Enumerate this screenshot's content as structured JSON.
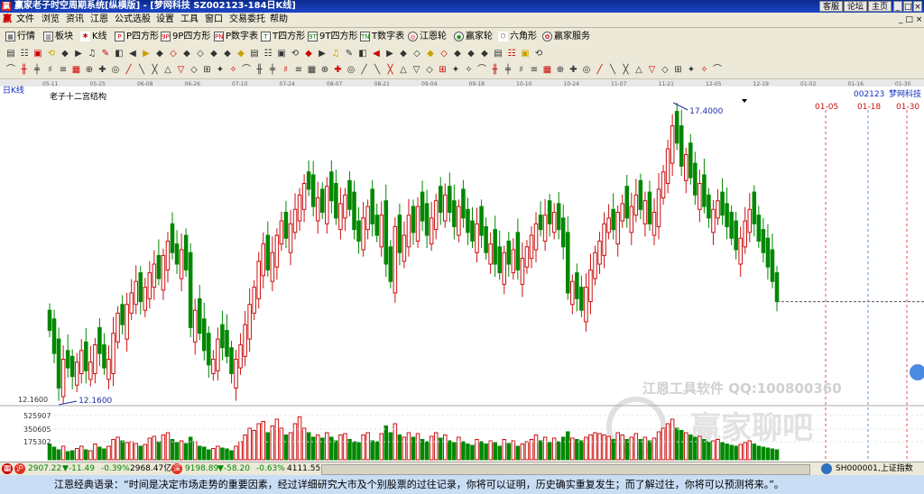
{
  "window": {
    "logo_text": "赢",
    "title": "赢家老子时空周期系统[纵横版] - [梦网科技  SZ002123-184日K线]",
    "buttons": [
      "客服",
      "论坛",
      "主页"
    ]
  },
  "menu": [
    "文件",
    "浏览",
    "资讯",
    "江恩",
    "公式选股",
    "设置",
    "工具",
    "窗口",
    "交易委托",
    "帮助"
  ],
  "toolbar1": [
    {
      "icon": "grid-icon",
      "label": "行情"
    },
    {
      "icon": "blocks-icon",
      "label": "板块"
    },
    {
      "icon": "candle-icon",
      "label": "K线"
    },
    {
      "icon": "P",
      "label": "P四方形"
    },
    {
      "icon": "9P",
      "label": "9P四方形"
    },
    {
      "icon": "PN",
      "label": "P数字表"
    },
    {
      "icon": "T",
      "label": "T四方形"
    },
    {
      "icon": "9T",
      "label": "9T四方形"
    },
    {
      "icon": "TN",
      "label": "T数字表"
    },
    {
      "icon": "wheel-icon",
      "label": "江恩轮"
    },
    {
      "icon": "wheel-icon",
      "label": "赢家轮"
    },
    {
      "icon": "hexagon-icon",
      "label": "六角形"
    },
    {
      "icon": "service-icon",
      "label": "赢家服务"
    }
  ],
  "chart_data": {
    "type": "candlestick",
    "period_label": "日K线",
    "indicator_label": "老子十二宫结构",
    "stock_code": "002123",
    "stock_name": "梦网科技",
    "x_dates": [
      "05-11",
      "05-25",
      "06-08",
      "06-26",
      "07-10",
      "07-24",
      "08-07",
      "08-21",
      "09-04",
      "09-18",
      "10-10",
      "10-24",
      "11-07",
      "11-21",
      "12-05",
      "12-19",
      "01-02",
      "01-16",
      "01-30"
    ],
    "future_marks": [
      "01-05",
      "01-18",
      "01-30"
    ],
    "high_label": "17.4000",
    "low_label": "12.1600",
    "low_axis_label": "12.1600",
    "ohlc_close": [
      13.45,
      13.05,
      12.45,
      12.95,
      12.8,
      12.65,
      12.9,
      13.1,
      12.75,
      12.9,
      13.2,
      13.05,
      12.8,
      12.95,
      13.4,
      13.75,
      13.55,
      13.9,
      14.1,
      14.3,
      13.95,
      14.2,
      14.45,
      14.6,
      14.35,
      14.75,
      15.0,
      14.8,
      14.6,
      14.85,
      14.5,
      13.5,
      13.8,
      13.4,
      13.1,
      12.85,
      12.95,
      13.3,
      13.15,
      13.0,
      12.7,
      12.95,
      13.2,
      13.55,
      13.9,
      14.2,
      14.65,
      14.95,
      14.5,
      14.8,
      15.1,
      15.35,
      15.05,
      15.3,
      15.55,
      15.8,
      16.0,
      15.9,
      15.6,
      15.75,
      15.5,
      15.95,
      15.7,
      15.4,
      15.65,
      15.8,
      15.55,
      15.2,
      15.0,
      15.4,
      15.6,
      15.3,
      15.1,
      15.45,
      14.6,
      14.3,
      15.25,
      14.8,
      15.1,
      15.45,
      15.15,
      15.6,
      15.35,
      15.1,
      15.4,
      15.7,
      15.5,
      15.8,
      15.5,
      15.25,
      15.6,
      15.4,
      15.15,
      15.0,
      15.3,
      15.1,
      14.8,
      14.95,
      14.6,
      14.45,
      14.8,
      14.6,
      14.85,
      14.5,
      14.7,
      14.9,
      15.1,
      15.3,
      15.2,
      15.45,
      15.3,
      15.5,
      15.2,
      14.9,
      14.1,
      14.3,
      14.0,
      13.8,
      14.2,
      14.5,
      14.8,
      15.0,
      15.3,
      15.4,
      15.2,
      15.5,
      15.65,
      15.4,
      15.6,
      15.8,
      15.55,
      15.7,
      15.3,
      15.5,
      15.9,
      16.2,
      16.6,
      17.0,
      16.7,
      16.3,
      16.5,
      16.1,
      15.8,
      16.0,
      15.6,
      15.4,
      15.55,
      15.7,
      15.45,
      15.25,
      15.05,
      14.85,
      15.05,
      15.35,
      15.55,
      15.3,
      15.0,
      14.8,
      14.55,
      14.3,
      13.95
    ],
    "ohlc_up": [
      false,
      false,
      false,
      true,
      false,
      false,
      true,
      true,
      false,
      true,
      true,
      false,
      false,
      true,
      true,
      true,
      false,
      true,
      true,
      true,
      false,
      true,
      true,
      true,
      false,
      true,
      true,
      false,
      false,
      true,
      false,
      false,
      true,
      false,
      false,
      false,
      true,
      true,
      false,
      false,
      false,
      true,
      true,
      true,
      true,
      true,
      true,
      true,
      false,
      true,
      true,
      true,
      false,
      true,
      true,
      true,
      true,
      false,
      false,
      true,
      false,
      true,
      false,
      false,
      true,
      true,
      false,
      false,
      false,
      true,
      true,
      false,
      false,
      true,
      false,
      false,
      true,
      false,
      true,
      true,
      false,
      true,
      false,
      false,
      true,
      true,
      false,
      true,
      false,
      false,
      true,
      false,
      false,
      false,
      true,
      false,
      false,
      true,
      false,
      false,
      true,
      false,
      true,
      false,
      true,
      true,
      true,
      true,
      false,
      true,
      false,
      true,
      false,
      false,
      false,
      true,
      false,
      false,
      true,
      true,
      true,
      true,
      true,
      true,
      false,
      true,
      true,
      false,
      true,
      true,
      false,
      true,
      false,
      true,
      true,
      true,
      true,
      true,
      false,
      false,
      true,
      false,
      false,
      true,
      false,
      false,
      true,
      true,
      false,
      false,
      false,
      false,
      true,
      true,
      true,
      false,
      false,
      false,
      false,
      false,
      false
    ],
    "volumes": [
      0.35,
      0.28,
      0.22,
      0.3,
      0.18,
      0.2,
      0.25,
      0.3,
      0.22,
      0.2,
      0.35,
      0.28,
      0.24,
      0.3,
      0.45,
      0.5,
      0.42,
      0.38,
      0.4,
      0.36,
      0.3,
      0.34,
      0.48,
      0.52,
      0.4,
      0.55,
      0.6,
      0.45,
      0.38,
      0.42,
      0.36,
      0.5,
      0.4,
      0.3,
      0.28,
      0.22,
      0.25,
      0.3,
      0.26,
      0.24,
      0.2,
      0.3,
      0.4,
      0.55,
      0.7,
      0.65,
      0.8,
      0.85,
      0.6,
      0.75,
      0.9,
      0.7,
      0.55,
      0.6,
      0.8,
      0.95,
      0.7,
      0.6,
      0.5,
      0.55,
      0.48,
      0.6,
      0.5,
      0.42,
      0.55,
      0.58,
      0.45,
      0.4,
      0.38,
      0.55,
      0.6,
      0.42,
      0.4,
      0.58,
      0.75,
      0.6,
      0.8,
      0.55,
      0.5,
      0.6,
      0.5,
      0.58,
      0.45,
      0.4,
      0.52,
      0.6,
      0.48,
      0.55,
      0.42,
      0.38,
      0.5,
      0.4,
      0.35,
      0.32,
      0.45,
      0.4,
      0.35,
      0.42,
      0.38,
      0.3,
      0.45,
      0.36,
      0.42,
      0.3,
      0.35,
      0.4,
      0.45,
      0.55,
      0.42,
      0.5,
      0.38,
      0.48,
      0.4,
      0.5,
      0.62,
      0.48,
      0.45,
      0.42,
      0.5,
      0.55,
      0.6,
      0.58,
      0.55,
      0.52,
      0.45,
      0.6,
      0.55,
      0.45,
      0.5,
      0.58,
      0.45,
      0.5,
      0.42,
      0.48,
      0.62,
      0.7,
      0.8,
      0.9,
      0.7,
      0.65,
      0.6,
      0.55,
      0.5,
      0.52,
      0.45,
      0.4,
      0.42,
      0.45,
      0.38,
      0.35,
      0.32,
      0.3,
      0.34,
      0.38,
      0.42,
      0.35,
      0.3,
      0.28,
      0.26,
      0.24,
      0.22
    ],
    "vol_labels": [
      "525907",
      "350605",
      "175302"
    ]
  },
  "watermark": {
    "line1": "江恩工具软件  QQ:100800360",
    "line2": "赢家聊吧"
  },
  "status": {
    "sh_index": "2907.22",
    "sh_change": "-11.49",
    "sh_pct": "-0.39%",
    "sh_amount": "2968.47亿",
    "sz_index": "9198.89",
    "sz_change": "-58.20",
    "sz_pct": "-0.63%",
    "sz_amount": "4111.55",
    "right_label": "SH000001,上证指数"
  },
  "quote": "江恩经典语录：“时间是决定市场走势的重要因素，经过详细研究大市及个别股票的过往记录，你将可以证明，历史确实重复发生；而了解过往，你将可以预测将来。”。",
  "colors": {
    "up": "#cc1010",
    "down": "#008800",
    "axis": "#333333",
    "future": "#e05050"
  }
}
